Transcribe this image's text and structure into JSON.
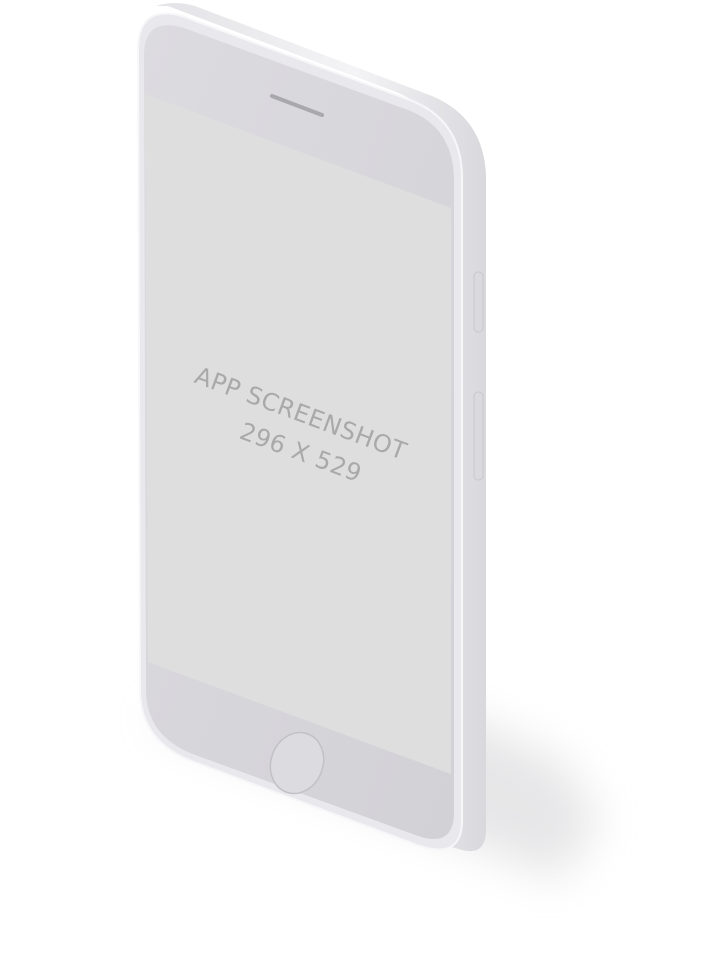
{
  "mockup": {
    "screen_text_line1": "APP SCREENSHOT",
    "screen_text_line2": "296 X 529"
  },
  "colors": {
    "background": "#ffffff",
    "body": "#e8e7ea",
    "body_edge": "#f6f6f8",
    "bezel": "#d8d7db",
    "screen": "#dedede",
    "placeholder_text": "#a9a9a9",
    "speaker": "#b8b7bc",
    "home_button_ring": "#bebdc2"
  },
  "icons": {
    "speaker": "speaker-grille-icon",
    "home": "home-button-icon"
  }
}
